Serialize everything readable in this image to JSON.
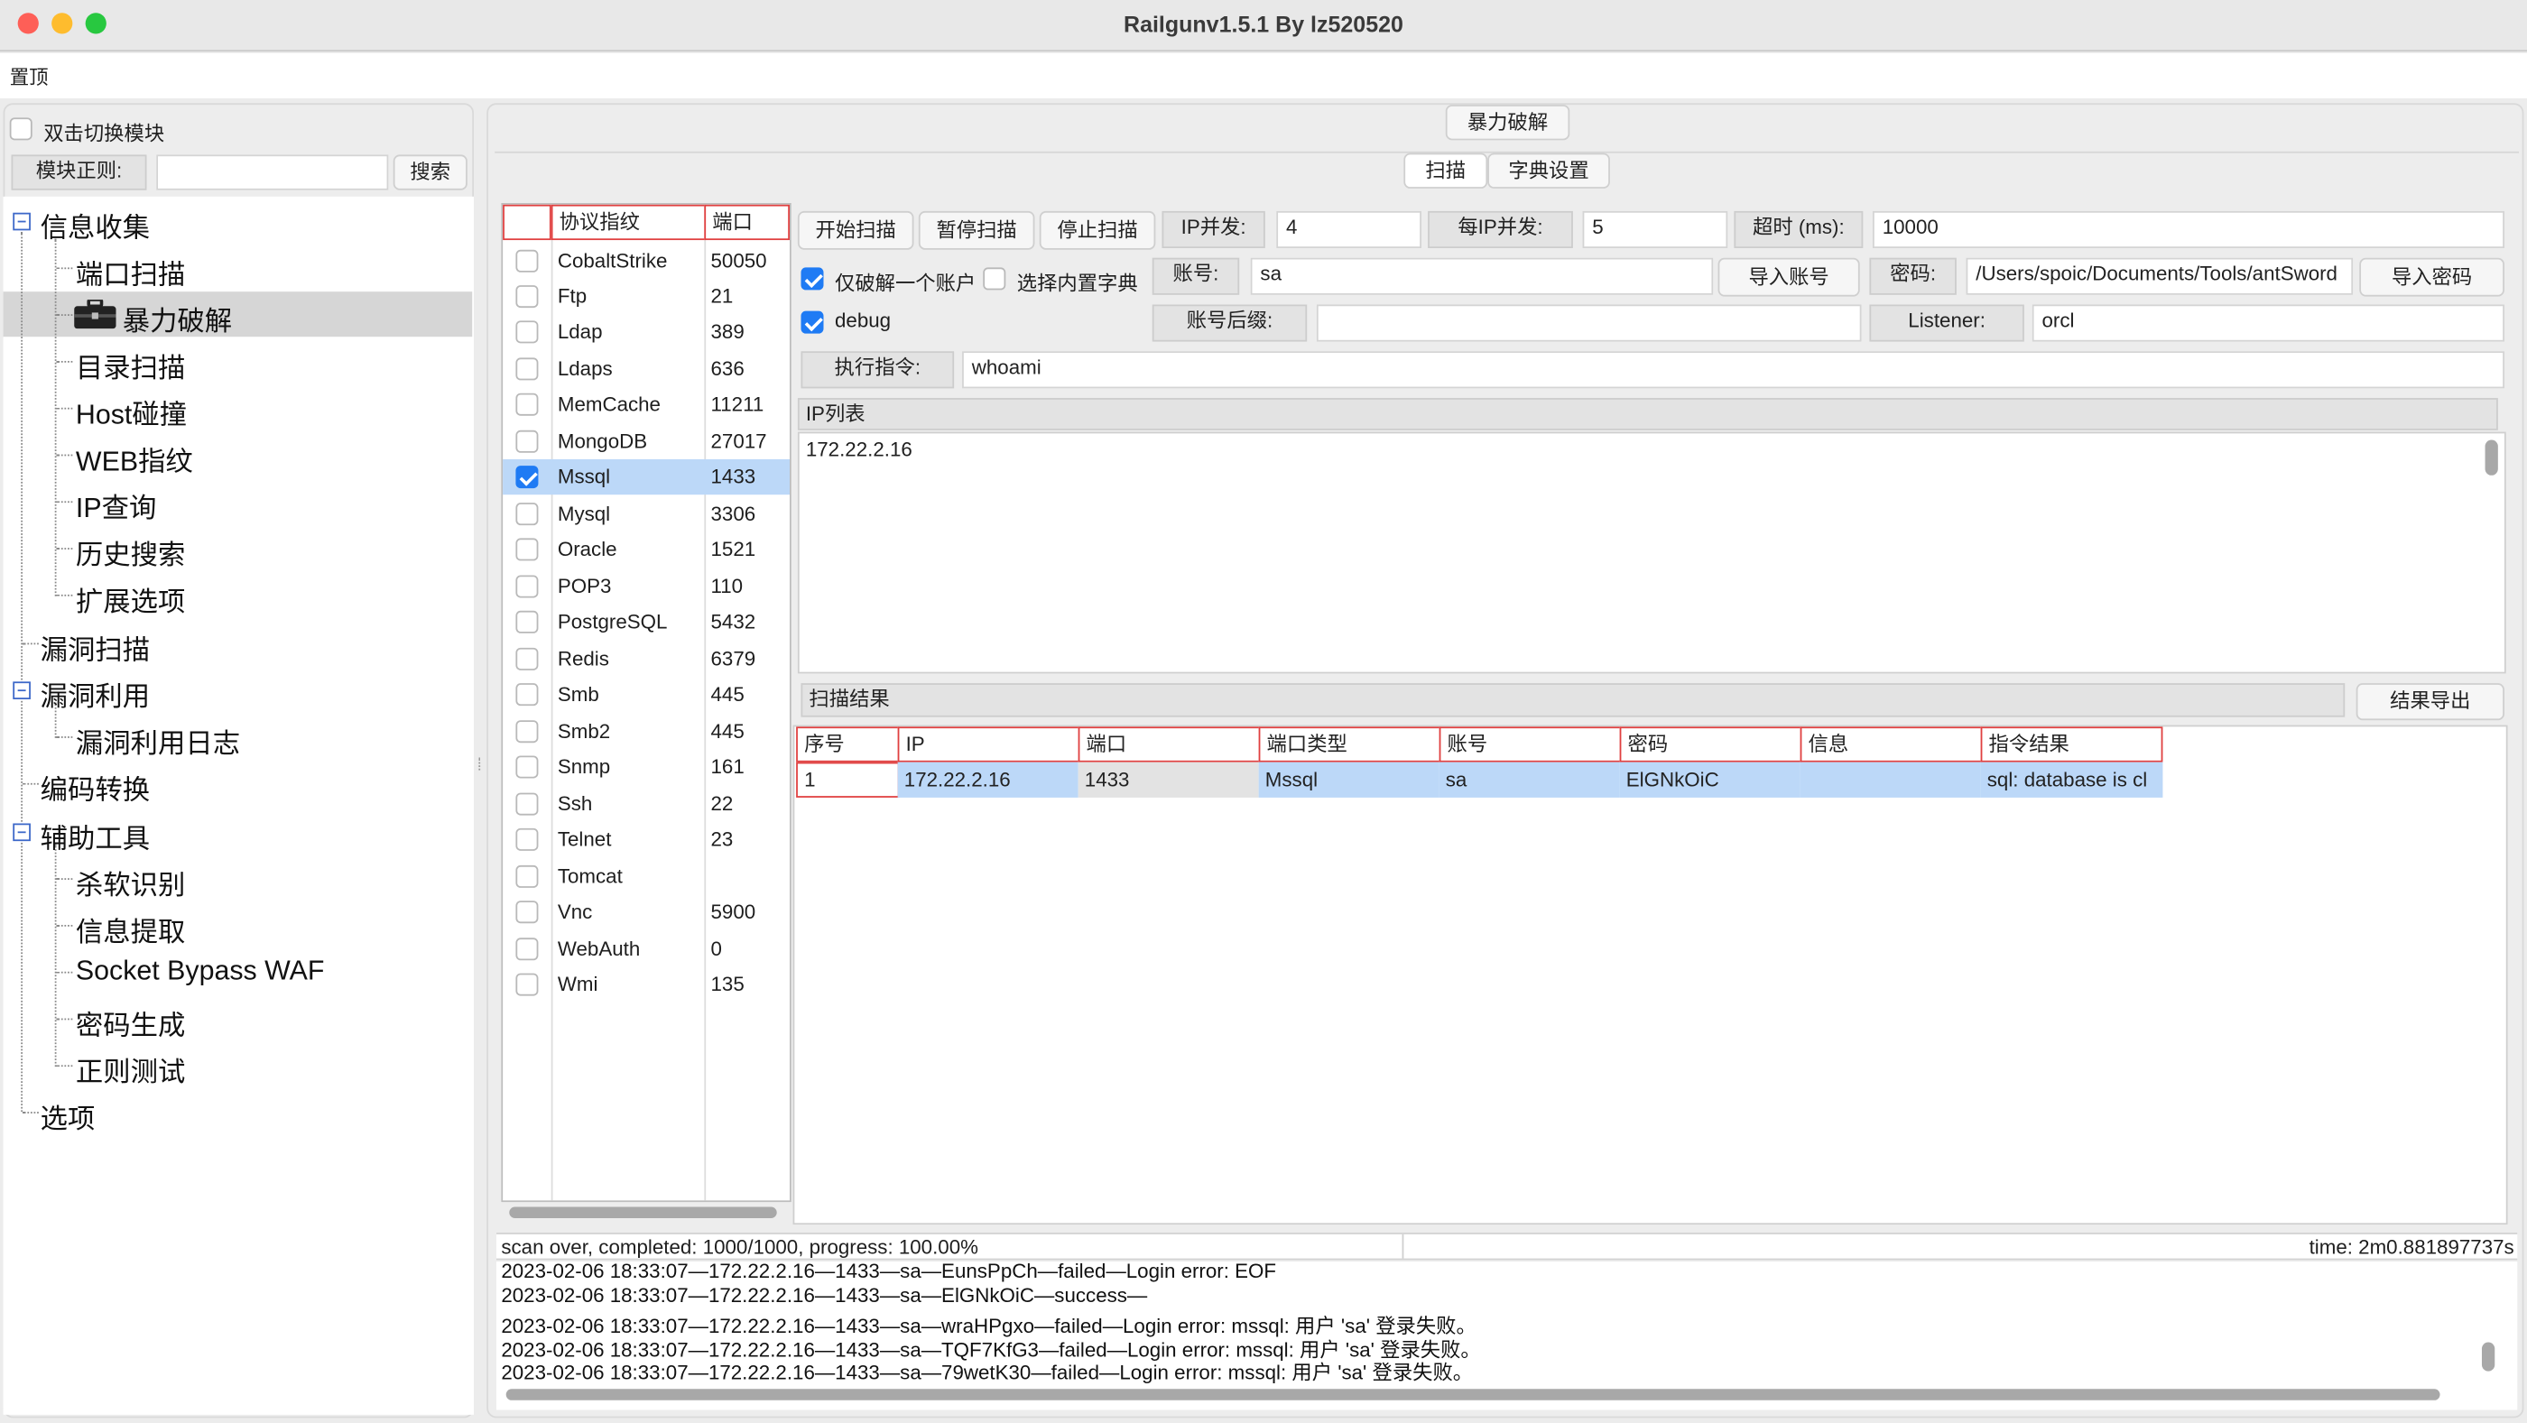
{
  "window": {
    "title": "Railgunv1.5.1 By lz520520",
    "traffic_lights": [
      "#fe5f57",
      "#febc2e",
      "#28c840"
    ]
  },
  "menu": {
    "pin_top": "置顶"
  },
  "sidebar": {
    "double_click_switch": "双击切换模块",
    "module_regex_label": "模块正则:",
    "module_regex_value": "",
    "search_button": "搜索",
    "tree": {
      "info_collect": "信息收集",
      "port_scan": "端口扫描",
      "brute_force": "暴力破解",
      "dir_scan": "目录扫描",
      "host_collide": "Host碰撞",
      "web_fingerprint": "WEB指纹",
      "ip_query": "IP查询",
      "history_search": "历史搜索",
      "ext_options": "扩展选项",
      "vuln_scan": "漏洞扫描",
      "vuln_exploit": "漏洞利用",
      "vuln_exploit_log": "漏洞利用日志",
      "encode_convert": "编码转换",
      "aux_tools": "辅助工具",
      "av_detect": "杀软识别",
      "info_extract": "信息提取",
      "socket_bypass": "Socket Bypass WAF",
      "pwd_gen": "密码生成",
      "regex_test": "正则测试",
      "options": "选项"
    }
  },
  "main": {
    "module_title": "暴力破解",
    "tabs": {
      "scan": "扫描",
      "dict": "字典设置"
    },
    "protocol_list": {
      "header_name": "协议指纹",
      "header_port": "端口",
      "items": [
        {
          "name": "CobaltStrike",
          "port": "50050",
          "checked": false
        },
        {
          "name": "Ftp",
          "port": "21",
          "checked": false
        },
        {
          "name": "Ldap",
          "port": "389",
          "checked": false
        },
        {
          "name": "Ldaps",
          "port": "636",
          "checked": false
        },
        {
          "name": "MemCache",
          "port": "11211",
          "checked": false
        },
        {
          "name": "MongoDB",
          "port": "27017",
          "checked": false
        },
        {
          "name": "Mssql",
          "port": "1433",
          "checked": true
        },
        {
          "name": "Mysql",
          "port": "3306",
          "checked": false
        },
        {
          "name": "Oracle",
          "port": "1521",
          "checked": false
        },
        {
          "name": "POP3",
          "port": "110",
          "checked": false
        },
        {
          "name": "PostgreSQL",
          "port": "5432",
          "checked": false
        },
        {
          "name": "Redis",
          "port": "6379",
          "checked": false
        },
        {
          "name": "Smb",
          "port": "445",
          "checked": false
        },
        {
          "name": "Smb2",
          "port": "445",
          "checked": false
        },
        {
          "name": "Snmp",
          "port": "161",
          "checked": false
        },
        {
          "name": "Ssh",
          "port": "22",
          "checked": false
        },
        {
          "name": "Telnet",
          "port": "23",
          "checked": false
        },
        {
          "name": "Tomcat",
          "port": "",
          "checked": false
        },
        {
          "name": "Vnc",
          "port": "5900",
          "checked": false
        },
        {
          "name": "WebAuth",
          "port": "0",
          "checked": false
        },
        {
          "name": "Wmi",
          "port": "135",
          "checked": false
        }
      ]
    },
    "controls": {
      "start_scan": "开始扫描",
      "pause_scan": "暂停扫描",
      "stop_scan": "停止扫描",
      "ip_concurrency_label": "IP并发:",
      "ip_concurrency_value": "4",
      "per_ip_label": "每IP并发:",
      "per_ip_value": "5",
      "timeout_label": "超时 (ms):",
      "timeout_value": "10000",
      "crack_one_label": "仅破解一个账户",
      "builtin_dict_label": "选择内置字典",
      "account_label": "账号:",
      "account_value": "sa",
      "import_account": "导入账号",
      "password_label": "密码:",
      "password_value": "/Users/spoic/Documents/Tools/antSword",
      "import_password": "导入密码",
      "debug_label": "debug",
      "account_suffix_label": "账号后缀:",
      "account_suffix_value": "",
      "listener_label": "Listener:",
      "listener_value": "orcl",
      "exec_cmd_label": "执行指令:",
      "exec_cmd_value": "whoami"
    },
    "ip_list": {
      "title": "IP列表",
      "content": "172.22.2.16"
    },
    "results": {
      "title": "扫描结果",
      "export_button": "结果导出",
      "columns": [
        "序号",
        "IP",
        "端口",
        "端口类型",
        "账号",
        "密码",
        "信息",
        "指令结果"
      ],
      "rows": [
        [
          "1",
          "172.22.2.16",
          "1433",
          "Mssql",
          "sa",
          "ElGNkOiC",
          "",
          "sql: database is cl"
        ]
      ]
    },
    "status": {
      "left": "scan over, completed: 1000/1000, progress: 100.00%",
      "right": "time: 2m0.881897737s"
    },
    "log": [
      "2023-02-06 18:33:07—172.22.2.16—1433—sa—EunsPpCh—failed—Login error: EOF",
      "2023-02-06 18:33:07—172.22.2.16—1433—sa—ElGNkOiC—success—",
      "2023-02-06 18:33:07—172.22.2.16—1433—sa—wraHPgxo—failed—Login error: mssql: 用户 'sa' 登录失败。",
      "2023-02-06 18:33:07—172.22.2.16—1433—sa—TQF7KfG3—failed—Login error: mssql: 用户 'sa' 登录失败。",
      "2023-02-06 18:33:07—172.22.2.16—1433—sa—79wetK30—failed—Login error: mssql: 用户 'sa' 登录失败。"
    ]
  }
}
